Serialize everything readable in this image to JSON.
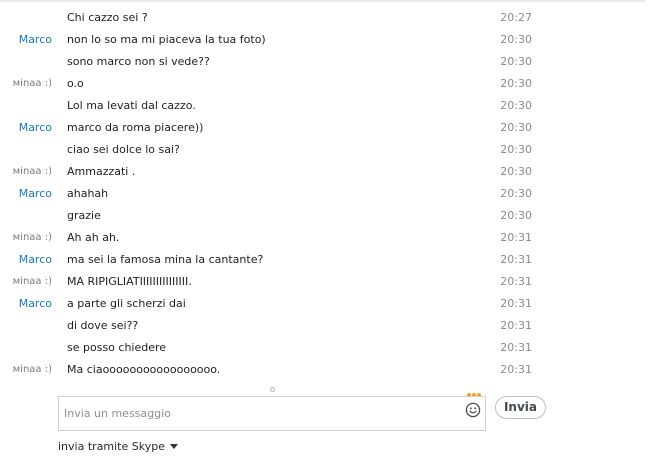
{
  "conversation": {
    "messages": [
      {
        "sender": "",
        "sender_type": "self",
        "text": "Chi cazzo sei ?",
        "time": "20:27"
      },
      {
        "sender": "Marco",
        "sender_type": "other",
        "text": "non lo so ma mi piaceva la tua foto)",
        "time": "20:30"
      },
      {
        "sender": "",
        "sender_type": "other",
        "text": "sono marco non si vede??",
        "time": "20:30"
      },
      {
        "sender": "мinaa :)",
        "sender_type": "self",
        "text": "o.o",
        "time": "20:30"
      },
      {
        "sender": "",
        "sender_type": "self",
        "text": "Lol ma levati dal cazzo.",
        "time": "20:30"
      },
      {
        "sender": "Marco",
        "sender_type": "other",
        "text": "marco da roma piacere))",
        "time": "20:30"
      },
      {
        "sender": "",
        "sender_type": "other",
        "text": "ciao sei dolce lo sai?",
        "time": "20:30"
      },
      {
        "sender": "мinaa :)",
        "sender_type": "self",
        "text": "Ammazzati .",
        "time": "20:30"
      },
      {
        "sender": "Marco",
        "sender_type": "other",
        "text": "ahahah",
        "time": "20:30"
      },
      {
        "sender": "",
        "sender_type": "other",
        "text": "grazie",
        "time": "20:30"
      },
      {
        "sender": "мinaa :)",
        "sender_type": "self",
        "text": "Ah ah ah.",
        "time": "20:31"
      },
      {
        "sender": "Marco",
        "sender_type": "other",
        "text": "ma sei la famosa mina la cantante?",
        "time": "20:31"
      },
      {
        "sender": "мinaa :)",
        "sender_type": "self",
        "text": "MA RIPIGLIATIIIIIIIIIIIIIII.",
        "time": "20:31"
      },
      {
        "sender": "Marco",
        "sender_type": "other",
        "text": "a parte gli scherzi dai",
        "time": "20:31"
      },
      {
        "sender": "",
        "sender_type": "other",
        "text": "di dove sei??",
        "time": "20:31"
      },
      {
        "sender": "",
        "sender_type": "other",
        "text": "se posso chiedere",
        "time": "20:31"
      },
      {
        "sender": "мinaa :)",
        "sender_type": "self",
        "text": "Ma ciaooooooooooooooooo.",
        "time": "20:31"
      }
    ]
  },
  "compose": {
    "placeholder": "Invia un messaggio",
    "value": "",
    "send_label": "Invia",
    "send_via_label": "invia tramite Skype",
    "emoji_icon": "smiley-icon",
    "typing_indicator_icon": "typing-dots-icon",
    "typing_indicator_color": "#f2a01a"
  },
  "colors": {
    "contact_name": "#1a78c2",
    "self_name": "#7a7a7a",
    "timestamp": "#8a8a8a"
  }
}
